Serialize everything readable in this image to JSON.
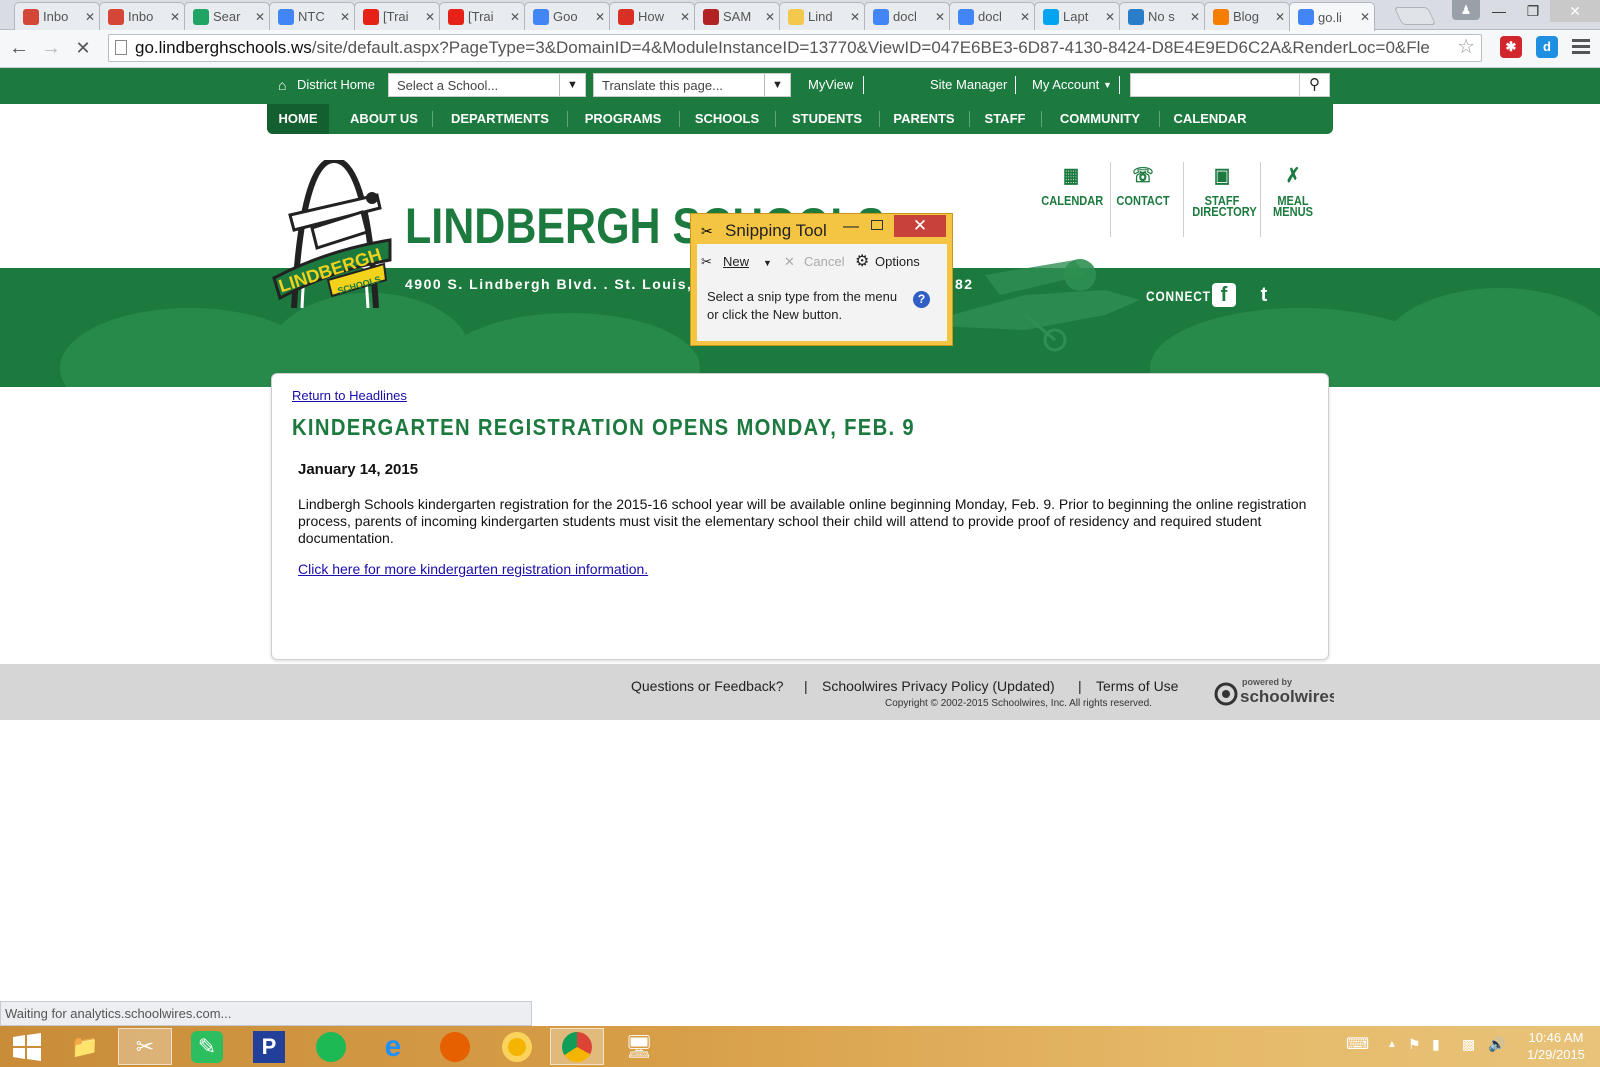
{
  "browser": {
    "tabs": [
      {
        "label": "Inbo",
        "icon": "gmail-icon",
        "color": "#d44638"
      },
      {
        "label": "Inbo",
        "icon": "gmail-icon",
        "color": "#d44638"
      },
      {
        "label": "Sear",
        "icon": "google-drive-icon",
        "color": "#1fa463"
      },
      {
        "label": "NTC",
        "icon": "google-docs-icon",
        "color": "#4285f4"
      },
      {
        "label": "[Trai",
        "icon": "youtube-icon",
        "color": "#e62117"
      },
      {
        "label": "[Trai",
        "icon": "youtube-icon",
        "color": "#e62117"
      },
      {
        "label": "Goo",
        "icon": "google-calendar-icon",
        "color": "#4285f4"
      },
      {
        "label": "How",
        "icon": "t-icon",
        "color": "#d93025"
      },
      {
        "label": "SAM",
        "icon": "school-icon",
        "color": "#b22222"
      },
      {
        "label": "Lind",
        "icon": "loading-icon",
        "color": "#f2c94c"
      },
      {
        "label": "docl",
        "icon": "google-icon",
        "color": "#4285f4"
      },
      {
        "label": "docl",
        "icon": "google-icon",
        "color": "#4285f4"
      },
      {
        "label": "Lapt",
        "icon": "windows-icon",
        "color": "#00a4ef"
      },
      {
        "label": "No s",
        "icon": "arrow-icon",
        "color": "#2a7ec9"
      },
      {
        "label": "Blog",
        "icon": "blogger-icon",
        "color": "#f57d00"
      },
      {
        "label": "go.li",
        "icon": "loading-icon",
        "color": "#4285f4"
      }
    ],
    "url_host": "go.lindberghschools.ws",
    "url_path": "/site/default.aspx?PageType=3&DomainID=4&ModuleInstanceID=13770&ViewID=047E6BE3-6D87-4130-8424-D8E4E9ED6C2A&RenderLoc=0&Fle",
    "status": "Waiting for analytics.schoolwires.com..."
  },
  "site": {
    "topbar": {
      "district_home": "District Home",
      "school_select": "Select a School...",
      "translate_select": "Translate this page...",
      "myview": "MyView",
      "site_manager": "Site Manager",
      "my_account": "My Account"
    },
    "nav": [
      "HOME",
      "ABOUT US",
      "DEPARTMENTS",
      "PROGRAMS",
      "SCHOOLS",
      "STUDENTS",
      "PARENTS",
      "STAFF",
      "COMMUNITY",
      "CALENDAR"
    ],
    "title": "LINDBERGH SCHOOLS",
    "logo_text": [
      "LINDBERGH",
      "SCHOOLS"
    ],
    "address": "4900 S. Lindbergh Blvd. . St. Louis, MO",
    "address_tail": "82",
    "quicklinks": [
      {
        "label": "CALENDAR",
        "icon": "calendar-icon"
      },
      {
        "label": "CONTACT",
        "icon": "phone-icon"
      },
      {
        "label": "STAFF DIRECTORY",
        "icon": "id-card-icon"
      },
      {
        "label": "MEAL MENUS",
        "icon": "utensils-icon"
      }
    ],
    "connect": "CONNECT",
    "article": {
      "return_link": "Return to Headlines",
      "headline": "KINDERGARTEN REGISTRATION OPENS MONDAY, FEB. 9",
      "date": "January 14, 2015",
      "body": "Lindbergh Schools kindergarten registration for the 2015-16 school year will be available online beginning Monday, Feb. 9. Prior to beginning the online registration process, parents of incoming kindergarten students must visit the elementary school their child will attend to provide proof of residency and required student documentation.",
      "more_link": "Click here for more kindergarten registration information."
    },
    "footer": {
      "feedback": "Questions or Feedback?",
      "privacy": "Schoolwires Privacy Policy (Updated)",
      "terms": "Terms of Use",
      "sep": "|",
      "copyright": "Copyright © 2002-2015 Schoolwires, Inc. All rights reserved.",
      "powered_by": "powered by",
      "brand": "schoolwires"
    }
  },
  "snipping_tool": {
    "title": "Snipping Tool",
    "new_label": "New",
    "cancel_label": "Cancel",
    "options_label": "Options",
    "message": "Select a snip type from the menu or click the New button."
  },
  "taskbar": {
    "apps": [
      "windows-start",
      "file-explorer",
      "snipping-tool",
      "evernote",
      "pandora",
      "spotify",
      "internet-explorer",
      "firefox",
      "chrome-canary",
      "chrome",
      "remote-desktop"
    ],
    "time": "10:46 AM",
    "date": "1/29/2015"
  },
  "colors": {
    "brand_green": "#1d7a3f",
    "link": "#1a0dab",
    "snip_frame": "#f4c542"
  }
}
